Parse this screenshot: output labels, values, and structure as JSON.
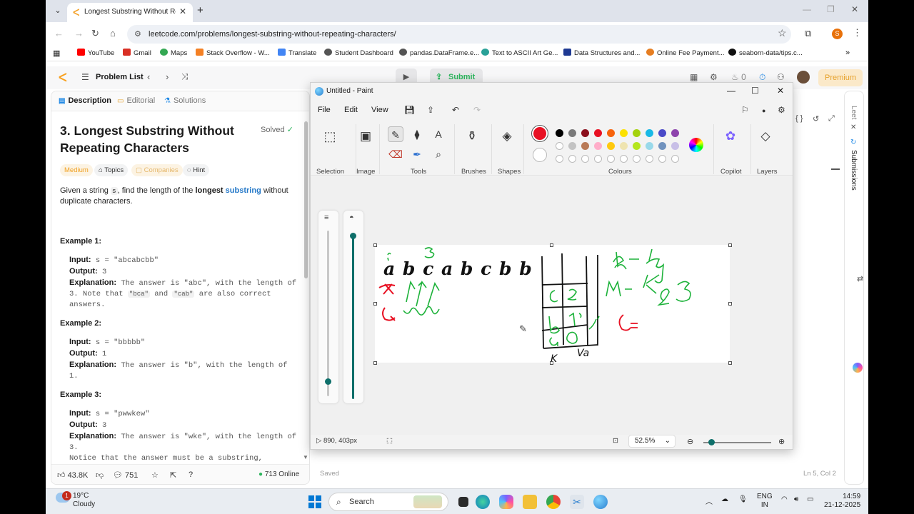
{
  "browser": {
    "tab_title": "Longest Substring Without Rep",
    "url": "leetcode.com/problems/longest-substring-without-repeating-characters/",
    "profile_initial": "S",
    "bookmarks": [
      "YouTube",
      "Gmail",
      "Maps",
      "Stack Overflow - W...",
      "Translate",
      "Student Dashboard",
      "pandas.DataFrame.e...",
      "Text to ASCII Art Ge...",
      "Data Structures and...",
      "Online Fee Payment...",
      "seaborn-data/tips.c..."
    ]
  },
  "leetcode": {
    "problem_list": "Problem List",
    "submit": "Submit",
    "streak": "0",
    "premium": "Premium",
    "tabs": [
      "Description",
      "Editorial",
      "Solutions"
    ],
    "title": "3. Longest Substring Without Repeating Characters",
    "solved": "Solved",
    "pills": [
      "Medium",
      "Topics",
      "Companies",
      "Hint"
    ],
    "desc_1": "Given a string ",
    "desc_code": "s",
    "desc_2": ", find the length of the ",
    "desc_bold": "longest",
    "desc_link": "substring",
    "desc_3": " without duplicate characters.",
    "examples": [
      {
        "title": "Example 1:",
        "input": "s = \"abcabcbb\"",
        "output": "3",
        "explanation_1": "The answer is \"abc\", with the length of 3. Note that ",
        "code_a": "\"bca\"",
        "and": " and ",
        "code_b": "\"cab\"",
        "explanation_2": " are also correct answers."
      },
      {
        "title": "Example 2:",
        "input": "s = \"bbbbb\"",
        "output": "1",
        "explanation_1": "The answer is \"b\", with the length of 1."
      },
      {
        "title": "Example 3:",
        "input": "s = \"pwwkew\"",
        "output": "3",
        "explanation_1": "The answer is \"wke\", with the length of 3.",
        "explanation_2": "Notice that the answer must be a substring,"
      }
    ],
    "labels": {
      "input": "Input:",
      "output": "Output:",
      "explanation": "Explanation:"
    },
    "likes": "43.8K",
    "comments": "751",
    "online": "713 Online",
    "status_saved": "Saved",
    "status_ln": "Ln 5, Col 2",
    "side_label_1": "Leet",
    "side_label_2": "Submissions"
  },
  "paint": {
    "title": "Untitled - Paint",
    "menus": [
      "File",
      "Edit",
      "View"
    ],
    "groups": [
      "Selection",
      "Image",
      "Tools",
      "Brushes",
      "Shapes",
      "Colours",
      "Copilot",
      "Layers"
    ],
    "palette_row1": [
      "#000000",
      "#7a7a7a",
      "#8b0f1c",
      "#e81123",
      "#f7630c",
      "#fce100",
      "#a4d20c",
      "#19b9e6",
      "#4949c8",
      "#8e44ad"
    ],
    "palette_row2": [
      "#ffffff",
      "#c3c3c3",
      "#b97a57",
      "#ffaec9",
      "#ffc90e",
      "#efe4b0",
      "#b5e61d",
      "#99d9ea",
      "#7092be",
      "#c8bfe7"
    ],
    "active_colour": "#e81123",
    "cursor_pos": "890, 403px",
    "zoom": "52.5%",
    "drawing": {
      "letters": "a b c a b c b b",
      "table_label_k": "K",
      "table_label_v": "Va"
    }
  },
  "taskbar": {
    "temp": "19°C",
    "weather": "Cloudy",
    "badge": "1",
    "search": "Search",
    "lang_1": "ENG",
    "lang_2": "IN",
    "time": "14:59",
    "date": "21-12-2025"
  }
}
